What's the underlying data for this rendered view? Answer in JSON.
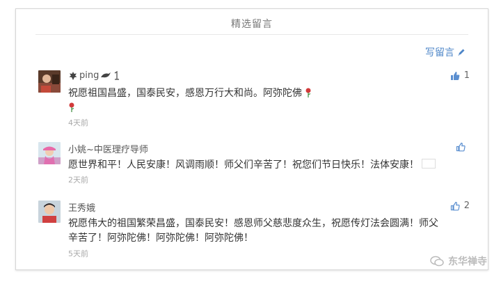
{
  "section": {
    "title": "精选留言",
    "write_label": "写留言"
  },
  "comments": [
    {
      "name_prefix": "",
      "name": "ping",
      "name_suffix": "",
      "content": "祝愿祖国昌盛，国泰民安，感恩万行大和尚。阿弥陀佛",
      "time": "4天前",
      "likes": "1"
    },
    {
      "name": "小姚~中医理疗导师",
      "content": "愿世界和平！人民安康！风调雨顺！师父们辛苦了！祝您们节日快乐！法体安康！",
      "time": "2天前",
      "likes": ""
    },
    {
      "name": "王秀娥",
      "content_line1": "祝愿伟大的祖国繁荣昌盛，国泰民安！感恩师父慈悲度众生，祝愿传灯法会圆满！师父",
      "content_line2": "辛苦了！阿弥陀佛！阿弥陀佛！阿弥陀佛！",
      "time": "5天前",
      "likes": "2"
    }
  ],
  "watermark": {
    "text": "东华禅寺"
  },
  "colors": {
    "link": "#4d86c8",
    "thumb": "#5b8fd0",
    "muted": "#aaaaaa"
  }
}
